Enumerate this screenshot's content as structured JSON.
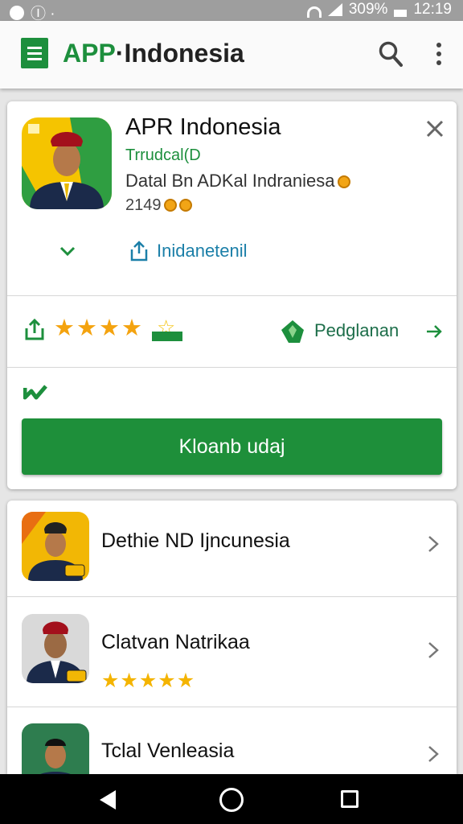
{
  "status_bar": {
    "left_glyphs": "Ⓘ ·",
    "battery_percent": "309%",
    "time": "12:19"
  },
  "app_bar": {
    "title_prefix": "APP",
    "title_suffix": "·Indonesia"
  },
  "card": {
    "app_name": "APR Indonesia",
    "subtitle": "Trrudcal(D",
    "description": "Datal Bn ADKal Indraniesa",
    "rating_count": "2149",
    "link_label": "Inidanetenil",
    "star_rating": 4,
    "badge_label": "Pedglanan",
    "install_label": "Kloanb udaj"
  },
  "list": {
    "items": [
      {
        "title": "Dethie ND Ijncunesia",
        "stars": 0
      },
      {
        "title": "Clatvan Natrikaa",
        "stars": 5
      },
      {
        "title": "Tclal Venleasia",
        "stars": 0
      }
    ]
  },
  "colors": {
    "accent_green": "#1d8f3d",
    "star_gold": "#f4a30f",
    "link_blue": "#1b7fa8"
  }
}
